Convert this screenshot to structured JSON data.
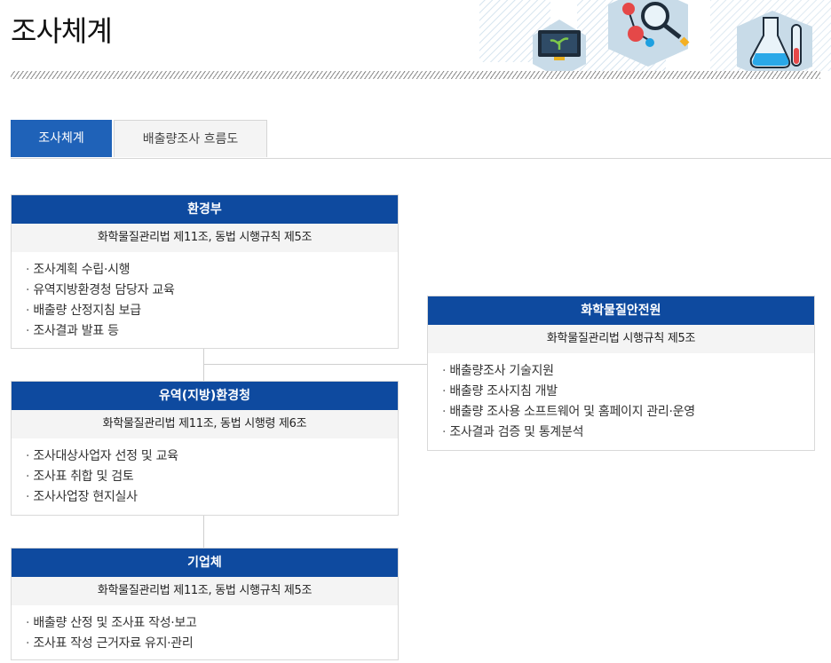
{
  "page": {
    "title": "조사체계"
  },
  "tabs": [
    {
      "label": "조사체계",
      "active": true
    },
    {
      "label": "배출량조사 흐름도",
      "active": false
    }
  ],
  "colors": {
    "header_blue": "#0e4a9f",
    "tab_blue": "#1f62b8",
    "law_bg": "#f4f4f4"
  },
  "org": {
    "moe": {
      "name": "환경부",
      "law": "화학물질관리법 제11조, 동법 시행규칙 제5조",
      "items": [
        "조사계획 수립·시행",
        "유역지방환경청 담당자 교육",
        "배출량 산정지침 보급",
        "조사결과 발표 등"
      ]
    },
    "regional": {
      "name": "유역(지방)환경청",
      "law": "화학물질관리법 제11조, 동법 시행령 제6조",
      "items": [
        "조사대상사업자 선정 및 교육",
        "조사표 취합 및 검토",
        "조사사업장 현지실사"
      ]
    },
    "company": {
      "name": "기업체",
      "law": "화학물질관리법 제11조, 동법 시행규칙 제5조",
      "items": [
        "배출량 산정 및 조사표 작성·보고",
        "조사표 작성 근거자료 유지·관리"
      ]
    },
    "nics": {
      "name": "화학물질안전원",
      "law": "화학물질관리법 시행규칙 제5조",
      "items": [
        "배출량조사 기술지원",
        "배출량 조사지침 개발",
        "배출량 조사용 소프트웨어 및 홈페이지 관리·운영",
        "조사결과 검증 및 통계분석"
      ]
    }
  }
}
